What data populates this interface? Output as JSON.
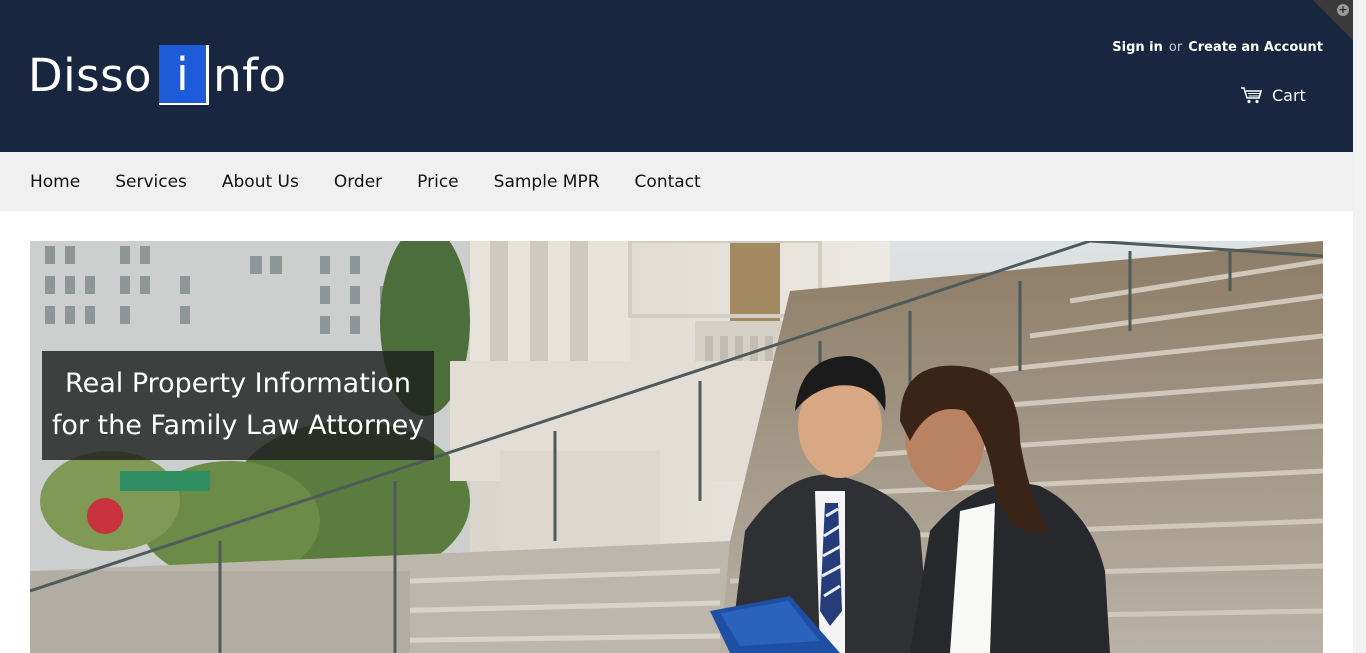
{
  "header": {
    "logo": {
      "part1": "Disso",
      "part2": "i",
      "part3": "nfo"
    },
    "account": {
      "sign_in": "Sign in",
      "or": "or",
      "create_account": "Create an Account"
    },
    "cart": {
      "label": "Cart",
      "icon": "cart-icon"
    }
  },
  "nav": {
    "items": [
      "Home",
      "Services",
      "About Us",
      "Order",
      "Price",
      "Sample MPR",
      "Contact"
    ]
  },
  "hero": {
    "caption_line1": "Real Property Information",
    "caption_line2": "for the Family Law Attorney"
  },
  "colors": {
    "header_bg": "#182640",
    "logo_accent": "#1e5bd8",
    "nav_bg": "#f0f0f0"
  }
}
